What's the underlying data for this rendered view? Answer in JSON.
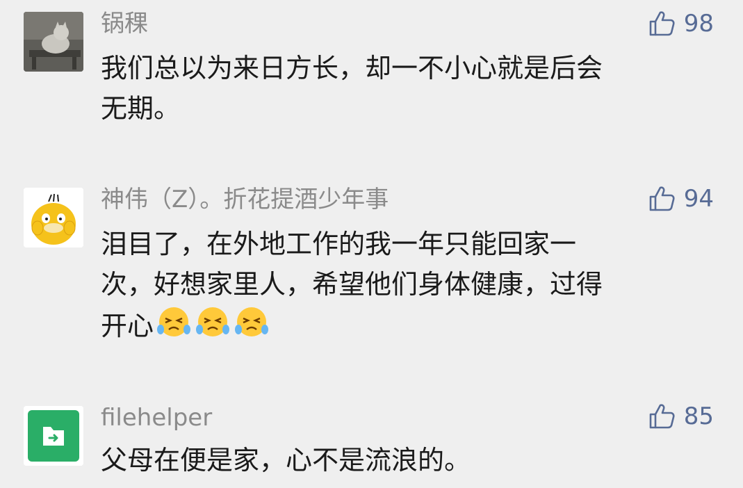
{
  "comments": [
    {
      "author": "锅稞",
      "likes": "98",
      "avatar_icon": "cat-photo-avatar",
      "lines": [
        "我们总以为来日方长，却一不小心就是后会",
        "无期。"
      ]
    },
    {
      "author": "神伟（Z）。折花提酒少年事",
      "likes": "94",
      "avatar_icon": "yellow-duck-avatar",
      "lines": [
        "泪目了，在外地工作的我一年只能回家一",
        "次，好想家里人，希望他们身体健康，过得",
        "开心"
      ],
      "emojis": [
        "crying-face-emoji",
        "crying-face-emoji",
        "crying-face-emoji"
      ]
    },
    {
      "author": "filehelper",
      "likes": "85",
      "avatar_icon": "file-transfer-avatar",
      "lines": [
        "父母在便是家，心不是流浪的。"
      ]
    }
  ],
  "colors": {
    "background": "#efefef",
    "author": "#8a8a8a",
    "like": "#576b95",
    "text": "#1a1a1a",
    "filehelper_green": "#2aae67"
  }
}
